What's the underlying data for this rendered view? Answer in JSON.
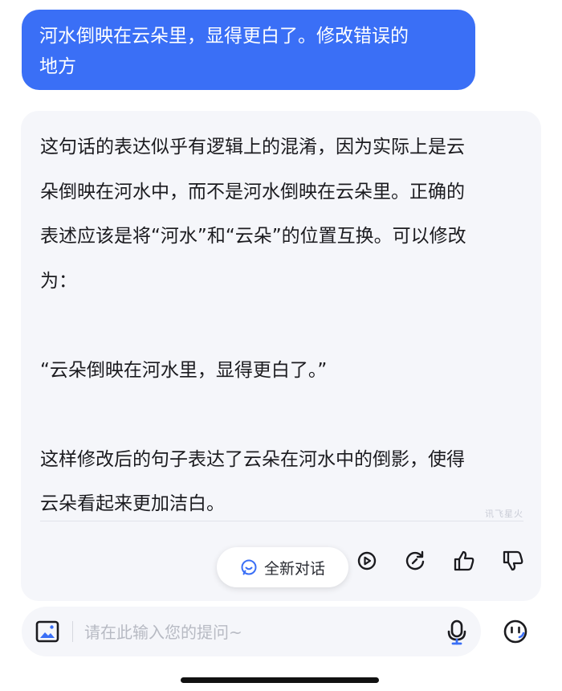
{
  "user_message": {
    "line1": "河水倒映在云朵里，显得更白了。修改错误的",
    "line2": "地方"
  },
  "assistant_message": {
    "lines": [
      "这句话的表达似乎有逻辑上的混淆，因为实际上是云",
      "朵倒映在河水中，而不是河水倒映在云朵里。正确的",
      "表述应该是将“河水”和“云朵”的位置互换。可以修改",
      "为：",
      "",
      "“云朵倒映在河水里，显得更白了。”",
      "",
      "这样修改后的句子表达了云朵在河水中的倒影，使得",
      "云朵看起来更加洁白。"
    ],
    "watermark": "讯飞星火"
  },
  "actions": {
    "new_chat_label": "全新对话",
    "icons": [
      "play-icon",
      "refresh-icon",
      "thumbs-up-icon",
      "thumbs-down-icon"
    ]
  },
  "input": {
    "placeholder": "请在此输入您的提问~"
  },
  "colors": {
    "user_bubble": "#3a6ff6",
    "card_bg": "#f5f6fa",
    "accent": "#3a6ff6"
  }
}
